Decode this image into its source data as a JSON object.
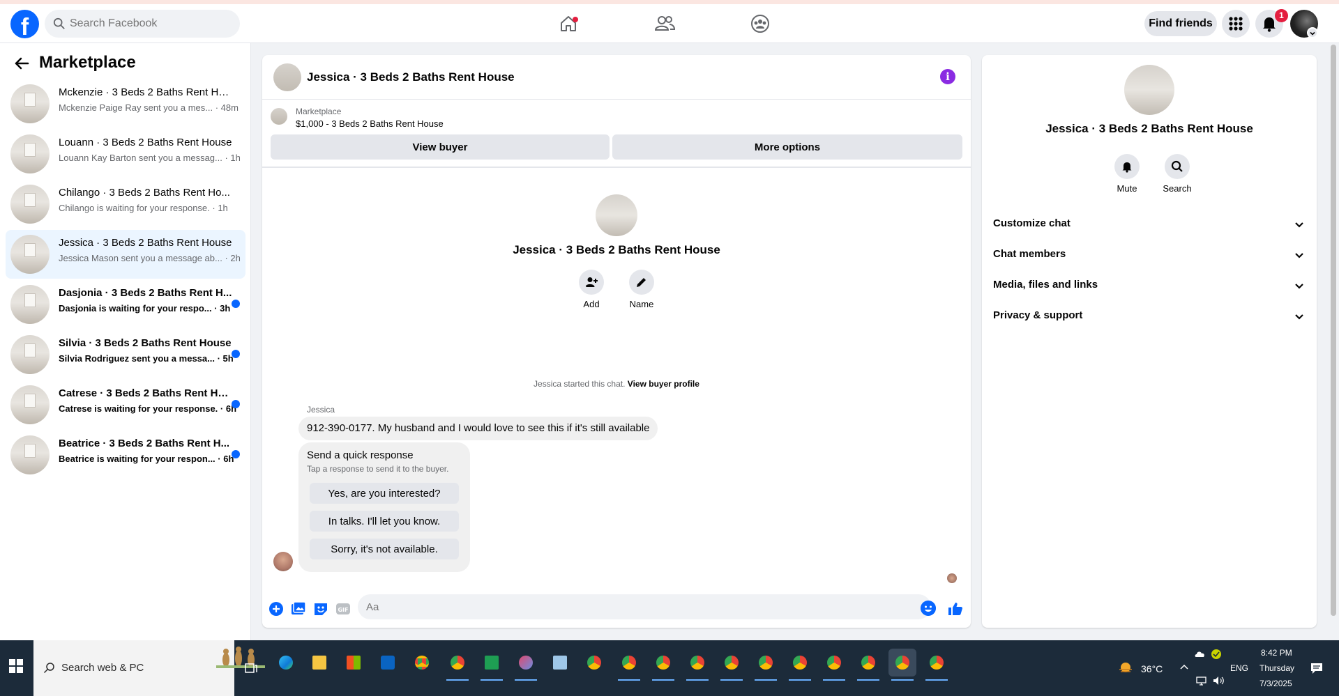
{
  "topbar": {
    "search_placeholder": "Search Facebook",
    "find_friends": "Find friends",
    "notification_count": "1",
    "brand_color": "#0866ff"
  },
  "sidebar": {
    "title": "Marketplace",
    "conversations": [
      {
        "name": "Mckenzie · 3 Beds 2 Baths Rent Ho...",
        "snippet": "Mckenzie Paige Ray sent you a mes... · 48m"
      },
      {
        "name": "Louann · 3 Beds 2 Baths Rent House",
        "snippet": "Louann Kay Barton sent you a messag... · 1h"
      },
      {
        "name": "Chilango · 3 Beds 2 Baths Rent Ho...",
        "snippet": "Chilango is waiting for your response. · 1h"
      },
      {
        "name": "Jessica · 3 Beds 2 Baths Rent House",
        "snippet": "Jessica Mason sent you a message ab... · 2h"
      },
      {
        "name": "Dasjonia · 3 Beds 2 Baths Rent H...",
        "snippet": "Dasjonia is waiting for your respo... · 3h"
      },
      {
        "name": "Silvia · 3 Beds 2 Baths Rent House",
        "snippet": "Silvia Rodriguez sent you a messa... · 5h"
      },
      {
        "name": "Catrese · 3 Beds 2 Baths Rent Ho...",
        "snippet": "Catrese is waiting for your response. · 6h"
      },
      {
        "name": "Beatrice · 3 Beds 2 Baths Rent H...",
        "snippet": "Beatrice is waiting for your respon... · 6h"
      }
    ]
  },
  "chat": {
    "title": "Jessica · 3 Beds 2 Baths Rent House",
    "marketplace_label": "Marketplace",
    "listing": "$1,000 - 3 Beds 2 Baths Rent House",
    "view_buyer": "View buyer",
    "more_options": "More options",
    "center_title": "Jessica · 3 Beds 2 Baths Rent House",
    "add_label": "Add",
    "name_label": "Name",
    "started_text": "Jessica started this chat.",
    "view_buyer_profile": "View buyer profile",
    "sender": "Jessica",
    "message": "912-390-0177. My husband and I would love to see this if it's still available",
    "quick_title": "Send a quick response",
    "quick_subtitle": "Tap a response to send it to the buyer.",
    "quick_replies": [
      "Yes, are you interested?",
      "In talks. I'll let you know.",
      "Sorry, it's not available."
    ],
    "composer_placeholder": "Aa"
  },
  "details": {
    "title": "Jessica · 3 Beds 2 Baths Rent House",
    "mute": "Mute",
    "search": "Search",
    "sections": [
      "Customize chat",
      "Chat members",
      "Media, files and links",
      "Privacy & support"
    ]
  },
  "taskbar": {
    "search_text": "Search web & PC",
    "temperature": "36°C",
    "language": "ENG",
    "time": "8:42 PM",
    "day": "Thursday",
    "date": "7/3/2025"
  }
}
